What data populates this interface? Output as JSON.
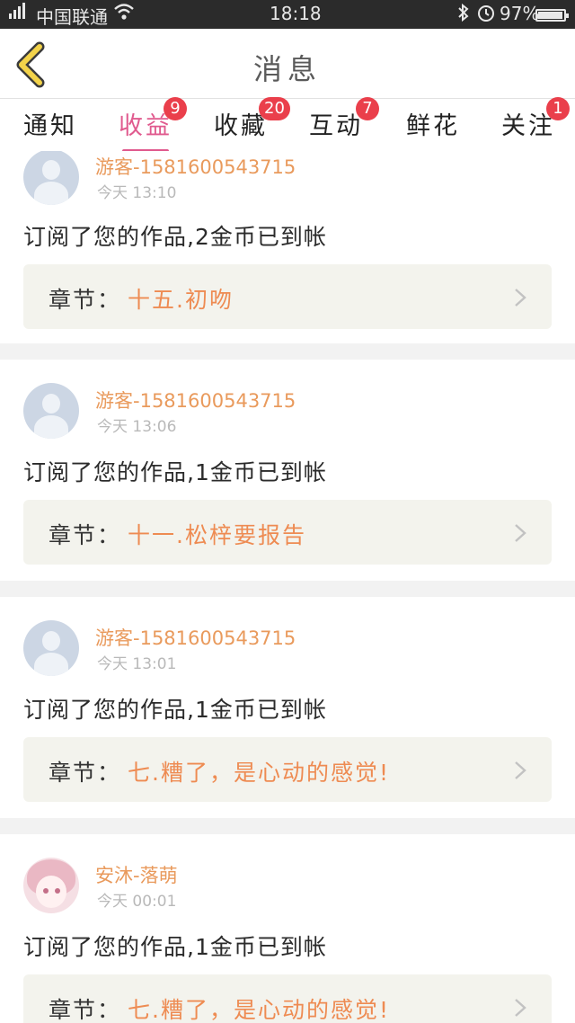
{
  "status_bar": {
    "carrier": "中国联通",
    "time": "18:18",
    "battery": "97%",
    "battery_level": 0.97
  },
  "header": {
    "title": "消息"
  },
  "tabs": [
    {
      "label": "通知",
      "badge": ""
    },
    {
      "label": "收益",
      "badge": "9"
    },
    {
      "label": "收藏",
      "badge": "20"
    },
    {
      "label": "互动",
      "badge": "7"
    },
    {
      "label": "鲜花",
      "badge": ""
    },
    {
      "label": "关注",
      "badge": "1"
    }
  ],
  "active_tab": 1,
  "messages": [
    {
      "user": "游客-1581600543715",
      "time": "今天 13:10",
      "text": "订阅了您的作品,2金币已到帐",
      "chapter_label": "章节：",
      "chapter": "十五.初吻",
      "avatar": "default-avatar"
    },
    {
      "user": "游客-1581600543715",
      "time": "今天 13:06",
      "text": "订阅了您的作品,1金币已到帐",
      "chapter_label": "章节：",
      "chapter": "十一.松梓要报告",
      "avatar": "default-avatar"
    },
    {
      "user": "游客-1581600543715",
      "time": "今天 13:01",
      "text": "订阅了您的作品,1金币已到帐",
      "chapter_label": "章节：",
      "chapter": "七.糟了，是心动的感觉!",
      "avatar": "default-avatar"
    },
    {
      "user": "安沐-落萌",
      "time": "今天 00:01",
      "text": "订阅了您的作品,1金币已到帐",
      "chapter_label": "章节：",
      "chapter": "七.糟了，是心动的感觉!",
      "avatar": "anime-avatar"
    }
  ],
  "colors": {
    "accent": "#e05a8e",
    "badge": "#ea3f4b",
    "username": "#e99a5c",
    "chapter": "#ee8b52",
    "back_arrow": "#f3d34a"
  }
}
